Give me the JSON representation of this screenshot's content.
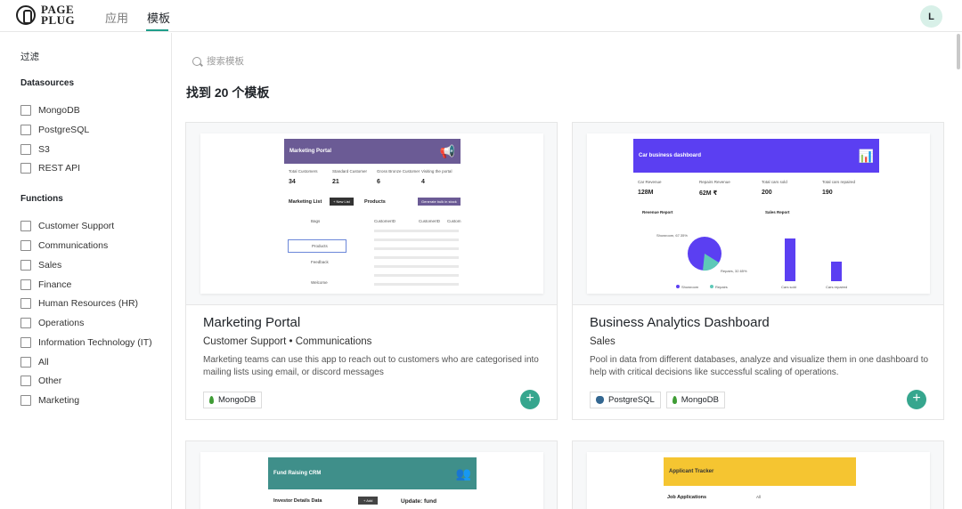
{
  "header": {
    "logo_line1": "PAGE",
    "logo_line2": "PLUG",
    "tabs": [
      {
        "label": "应用"
      },
      {
        "label": "模板"
      }
    ],
    "avatar_initial": "L"
  },
  "sidebar": {
    "filter_title": "过滤",
    "datasources_title": "Datasources",
    "datasources": [
      "MongoDB",
      "PostgreSQL",
      "S3",
      "REST API"
    ],
    "functions_title": "Functions",
    "functions": [
      "Customer Support",
      "Communications",
      "Sales",
      "Finance",
      "Human Resources (HR)",
      "Operations",
      "Information Technology (IT)",
      "All",
      "Other",
      "Marketing"
    ]
  },
  "main": {
    "search_placeholder": "搜索模板",
    "count_title": "找到 20 个模板",
    "cards": [
      {
        "title": "Marketing Portal",
        "categories": "Customer Support • Communications",
        "description": "Marketing teams can use this app to reach out to customers who are categorised into mailing lists using email, or discord messages",
        "tags": [
          "MongoDB"
        ],
        "preview": {
          "bar_title": "Marketing Portal",
          "stats": [
            {
              "label": "Total Customers",
              "value": "34"
            },
            {
              "label": "Standard Customer",
              "value": "21"
            },
            {
              "label": "Gross Bronze Customer",
              "value": "6"
            },
            {
              "label": "Visiting the portal",
              "value": "4"
            }
          ],
          "list_title": "Marketing List",
          "list_button": "+ New List",
          "products_title": "Products",
          "products_button": "Generate bulk in stock",
          "list_items": [
            "Bags",
            "Products",
            "Feedback",
            "Welcome"
          ],
          "table_headers": [
            "CustomerID",
            "CustomerID",
            "Custom"
          ]
        }
      },
      {
        "title": "Business Analytics Dashboard",
        "categories": "Sales",
        "description": "Pool in data from different databases, analyze and visualize them in one dashboard to help with critical decisions like successful scaling of operations.",
        "tags": [
          "PostgreSQL",
          "MongoDB"
        ],
        "preview": {
          "bar_title": "Car business dashboard",
          "stats": [
            {
              "label": "Car Revenue",
              "value": "128M"
            },
            {
              "label": "Repairs Revenue",
              "value": "62M ₹"
            },
            {
              "label": "Total cars sold",
              "value": "200"
            },
            {
              "label": "Total cars repaired",
              "value": "190"
            }
          ],
          "revenue_title": "Revenue Report",
          "sales_title": "Sales Report",
          "pie_label1": "Showroom, 67.35%",
          "pie_label2": "Repairs, 32.65%",
          "legend1": "Showroom",
          "legend2": "Repairs",
          "bar_label1": "Cars sold",
          "bar_label2": "Cars repaired"
        }
      },
      {
        "preview": {
          "bar_title": "Fund Raising CRM",
          "left_title": "Investor Details Data",
          "left_button": "+ Add",
          "right_title": "Update: fund"
        }
      },
      {
        "preview": {
          "bar_title": "Applicant Tracker",
          "job_title": "Job Applications",
          "filter": "All"
        }
      }
    ]
  },
  "colors": {
    "accent": "#1f9e8a",
    "fork_button": "#36a68e",
    "marketing_purple": "#6b5b95",
    "analytics_blue": "#5b3ff2",
    "crm_teal": "#3f8f8a",
    "tracker_yellow": "#f5c531"
  }
}
